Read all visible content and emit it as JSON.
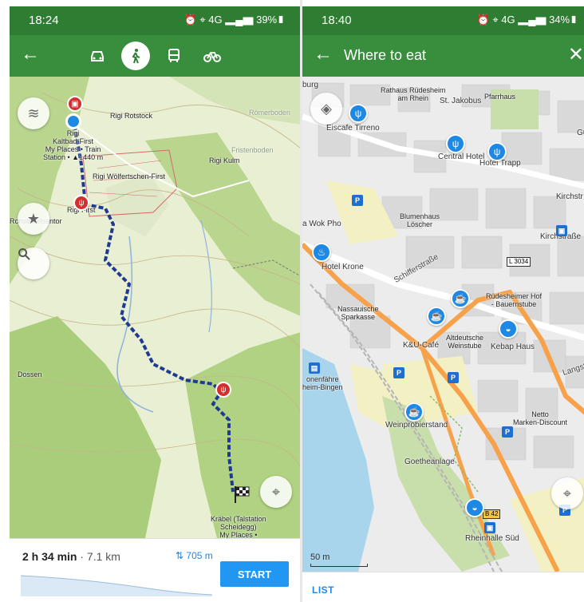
{
  "left": {
    "status_time": "18:24",
    "status_icons": "⏰ ⌖ 4G ▂▄▆ 39%▮",
    "modes": [
      "car-icon",
      "walk-icon",
      "bus-icon",
      "bike-icon"
    ],
    "active_mode": "walk-icon",
    "map_labels": {
      "rigi_rotstock": "Rigi Rotstock",
      "romerboden": "Römerboden",
      "fristenboden": "Fristenboden",
      "rigi_kulm": "Rigi Kulm",
      "rigi_kaltbad_first": "Rigi\nKaltbad-First\nMy Places • Train\nStation • ▲1440 m",
      "rigi_wolfertschen": "Rigi Wölfertschen-First",
      "rigi_first": "Rigi First",
      "romiti_felsentor": "Romiti Felsentor",
      "dossen": "Dossen",
      "krabel": "Kräbel (Talstation\nScheidegg)\nMy Places •\nAerialway Station"
    },
    "duration": "2 h 34 min",
    "distance": "· 7.1 km",
    "elevation": "⇅ 705 m",
    "start_label": "START"
  },
  "right": {
    "status_time": "18:40",
    "status_icons": "⏰ ⌖ 4G ▂▄▆ 34%▮",
    "title": "Where to eat",
    "map_labels": {
      "burg": "burg",
      "rathaus": "Rathaus Rüdesheim\nam Rhein",
      "st_jakobus": "St. Jakobus",
      "pfarrhaus": "Pfarrhaus",
      "eiscafe": "Eiscafe Tirreno",
      "central_hotel": "Central Hotel",
      "hotel_trapp": "Hotel Trapp",
      "gutsi": "Guts",
      "kirchstr1": "Kirchstr",
      "kirchstr2": "Kirchstraße",
      "wok_pho": "a Wok Pho",
      "blumenhaus": "Blumenhaus\nLöscher",
      "hotel_krone": "Hotel Krone",
      "schifferstrasse": "Schifferstraße",
      "l3034": "L 3034",
      "rudesheimer_hof": "Rüdesheimer Hof\n- Bauernstube",
      "nassauische": "Nassauische\nSparkasse",
      "altdeutsche": "Altdeutsche\nWeinstube",
      "kebap_haus": "Kebap Haus",
      "ku_cafe": "K&U-Café",
      "langstr": "Langstr",
      "fahre": "onenfähre\nheim-Bingen",
      "netto": "Netto\nMarken-Discount",
      "weinprobierstand": "Weinprobierstand",
      "goetheanlage": "Goetheanlage",
      "b42": "B 42",
      "rheinhalle": "Rheinhalle Süd",
      "scale": "50 m"
    },
    "list_label": "LIST"
  }
}
